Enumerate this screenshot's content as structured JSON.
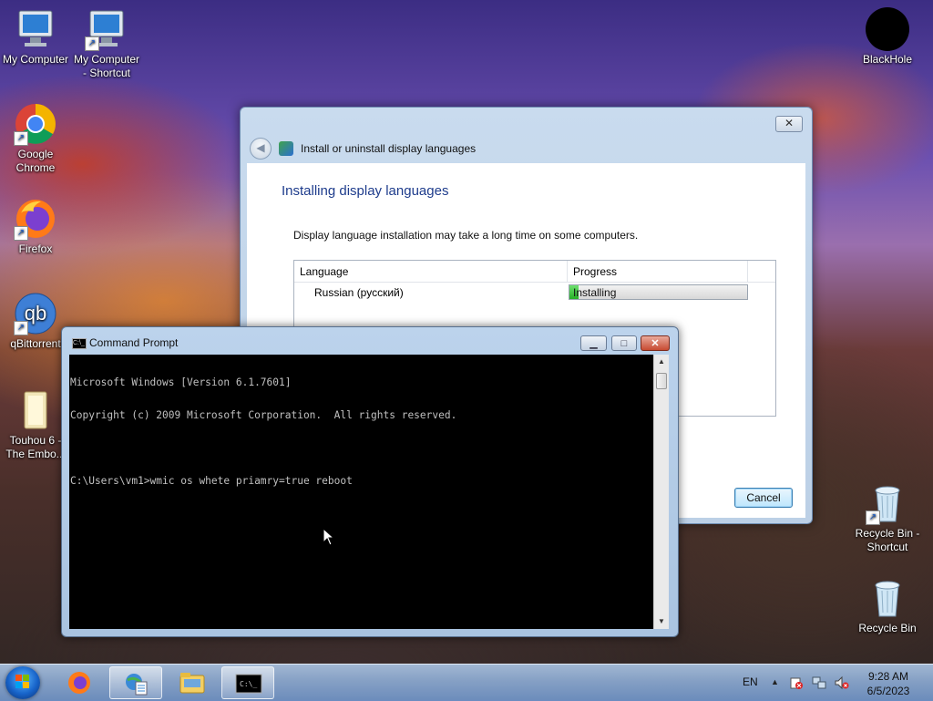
{
  "desktop": {
    "icons": [
      {
        "label": "My Computer"
      },
      {
        "label": "My Computer - Shortcut"
      },
      {
        "label": "Google Chrome"
      },
      {
        "label": "Firefox"
      },
      {
        "label": "qBittorrent"
      },
      {
        "label": "Touhou 6 - The Embo..."
      },
      {
        "label": "BlackHole"
      },
      {
        "label": "Recycle Bin - Shortcut"
      },
      {
        "label": "Recycle Bin"
      }
    ]
  },
  "lang_window": {
    "title": "Install or uninstall display languages",
    "heading": "Installing display languages",
    "description": "Display language installation may take a long time on some computers.",
    "table": {
      "headers": [
        "Language",
        "Progress"
      ],
      "rows": [
        {
          "language": "Russian (русский)",
          "status": "Installing",
          "progress": 0.05
        }
      ]
    },
    "cancel_label": "Cancel",
    "close_glyph": "✕"
  },
  "cmd_window": {
    "title": "Command Prompt",
    "icon_text": "C:\\_",
    "lines": [
      "Microsoft Windows [Version 6.1.7601]",
      "Copyright (c) 2009 Microsoft Corporation.  All rights reserved.",
      "",
      "C:\\Users\\vm1>wmic os whete priamry=true reboot"
    ],
    "min_glyph": "▁",
    "max_glyph": "□",
    "close_glyph": "✕"
  },
  "taskbar": {
    "language": "EN",
    "tray_expand": "▲",
    "clock_time": "9:28 AM",
    "clock_date": "6/5/2023"
  },
  "colors": {
    "accent_blue": "#1e3c8c",
    "progress_green": "#26b026",
    "console_bg": "#000000",
    "console_fg": "#c0c0c0"
  }
}
